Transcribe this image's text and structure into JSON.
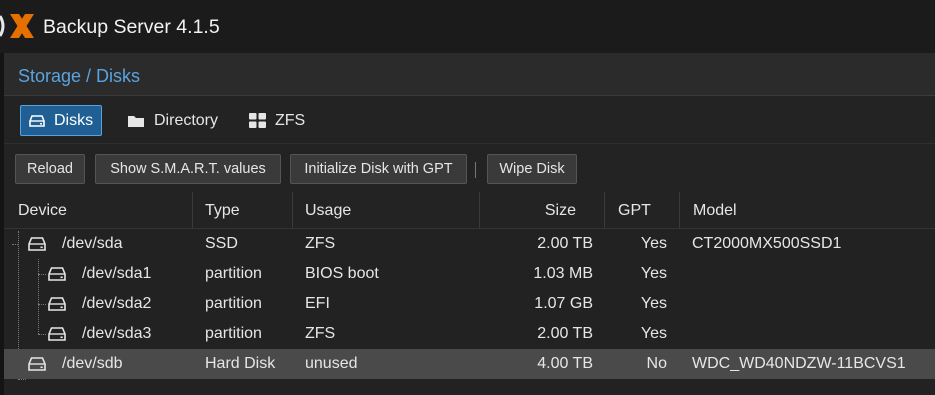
{
  "app": {
    "title": "Backup Server 4.1.5"
  },
  "breadcrumb": "Storage / Disks",
  "tabs": [
    {
      "label": "Disks",
      "icon": "drive-icon",
      "active": true
    },
    {
      "label": "Directory",
      "icon": "folder-icon",
      "active": false
    },
    {
      "label": "ZFS",
      "icon": "grid-icon",
      "active": false
    }
  ],
  "toolbar": {
    "reload": "Reload",
    "smart": "Show S.M.A.R.T. values",
    "init_gpt": "Initialize Disk with GPT",
    "wipe": "Wipe Disk"
  },
  "columns": {
    "device": "Device",
    "type": "Type",
    "usage": "Usage",
    "size": "Size",
    "gpt": "GPT",
    "model": "Model"
  },
  "rows": [
    {
      "device": "/dev/sda",
      "type": "SSD",
      "usage": "ZFS",
      "size": "2.00 TB",
      "gpt": "Yes",
      "model": "CT2000MX500SSD1"
    },
    {
      "device": "/dev/sda1",
      "type": "partition",
      "usage": "BIOS boot",
      "size": "1.03 MB",
      "gpt": "Yes",
      "model": ""
    },
    {
      "device": "/dev/sda2",
      "type": "partition",
      "usage": "EFI",
      "size": "1.07 GB",
      "gpt": "Yes",
      "model": ""
    },
    {
      "device": "/dev/sda3",
      "type": "partition",
      "usage": "ZFS",
      "size": "2.00 TB",
      "gpt": "Yes",
      "model": ""
    },
    {
      "device": "/dev/sdb",
      "type": "Hard Disk",
      "usage": "unused",
      "size": "4.00 TB",
      "gpt": "No",
      "model": "WDC_WD40NDZW-11BCVS1"
    }
  ],
  "colors": {
    "accent": "#1f5f93",
    "link": "#58a3e0",
    "logo_orange": "#e57000"
  }
}
